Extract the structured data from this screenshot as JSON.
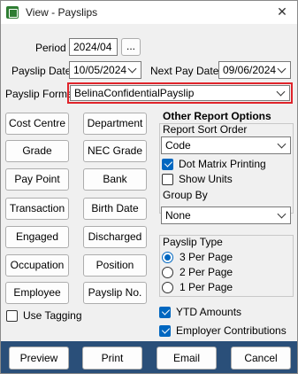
{
  "window": {
    "title": "View - Payslips",
    "close_glyph": "✕"
  },
  "period": {
    "label": "Period",
    "value": "2024/04",
    "browse_label": "..."
  },
  "payslip_date": {
    "label": "Payslip Date",
    "value": "10/05/2024"
  },
  "next_pay_date": {
    "label": "Next Pay Date",
    "value": "09/06/2024"
  },
  "payslip_format": {
    "label": "Payslip Format",
    "value": "BelinaConfidentialPayslip"
  },
  "report_buttons": [
    "Cost Centre",
    "Department",
    "Grade",
    "NEC Grade",
    "Pay Point",
    "Bank",
    "Transaction",
    "Birth Date",
    "Engaged",
    "Discharged",
    "Occupation",
    "Position",
    "Employee",
    "Payslip No."
  ],
  "use_tagging": {
    "label": "Use Tagging",
    "checked": false
  },
  "other_options": {
    "title": "Other Report Options",
    "sort_order_label": "Report Sort Order",
    "sort_order_value": "Code",
    "dot_matrix": {
      "label": "Dot Matrix Printing",
      "checked": true
    },
    "show_units": {
      "label": "Show Units",
      "checked": false
    },
    "group_by_label": "Group By",
    "group_by_value": "None"
  },
  "payslip_type": {
    "label": "Payslip Type",
    "options": [
      "3 Per Page",
      "2 Per Page",
      "1 Per Page"
    ],
    "selected": 0
  },
  "ytd_amounts": {
    "label": "YTD Amounts",
    "checked": true
  },
  "employer_contributions": {
    "label": "Employer Contributions",
    "checked": true
  },
  "actions": {
    "preview": "Preview",
    "print": "Print",
    "email": "Email",
    "cancel": "Cancel"
  },
  "colors": {
    "accent": "#0067c0",
    "highlight": "#e0242b",
    "footer": "#2a4f79"
  },
  "icons": {
    "app": "payroll-app-icon",
    "close": "close-icon",
    "chevron": "chevron-down-icon",
    "check": "check-icon"
  }
}
